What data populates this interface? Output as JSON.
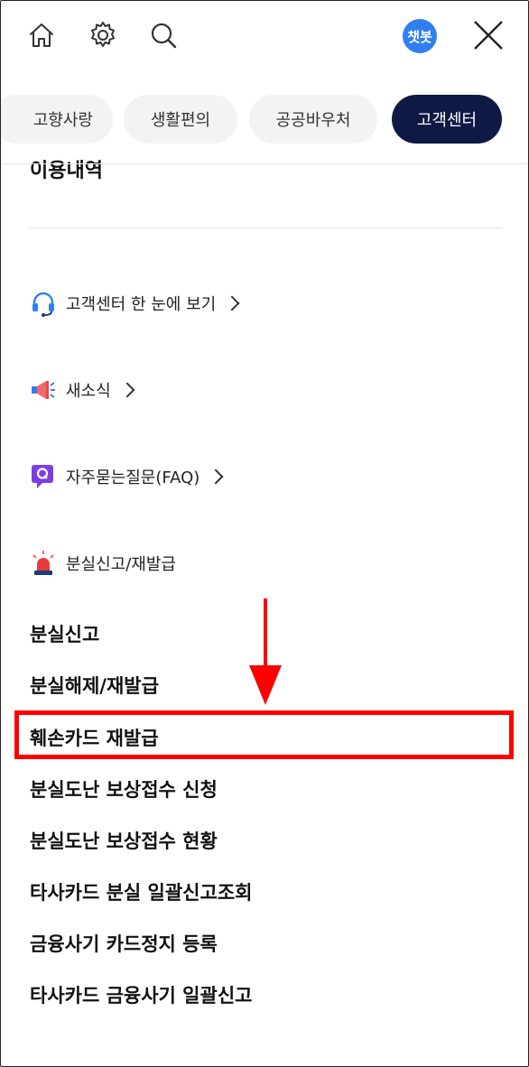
{
  "topbar": {
    "icons": [
      "home-icon",
      "gear-icon",
      "search-icon",
      "close-icon"
    ],
    "chatbot_label": "챗봇"
  },
  "chips": [
    {
      "label": "고향사랑",
      "active": false
    },
    {
      "label": "생활편의",
      "active": false
    },
    {
      "label": "공공바우처",
      "active": false
    },
    {
      "label": "고객센터",
      "active": true
    }
  ],
  "partial_heading": "이용내역",
  "menu_links": [
    {
      "label": "고객센터 한 눈에 보기",
      "icon": "headset-icon",
      "chevron": true
    },
    {
      "label": "새소식",
      "icon": "megaphone-icon",
      "chevron": true
    },
    {
      "label": "자주묻는질문(FAQ)",
      "icon": "faq-icon",
      "chevron": true
    },
    {
      "label": "분실신고/재발급",
      "icon": "siren-icon",
      "chevron": false
    }
  ],
  "sub_items": [
    "분실신고",
    "분실해제/재발급",
    "훼손카드 재발급",
    "분실도난 보상접수 신청",
    "분실도난 보상접수 현황",
    "타사카드 분실 일괄신고조회",
    "금융사기 카드정지 등록",
    "타사카드 금융사기 일괄신고"
  ],
  "colors": {
    "active_chip": "#0e1a45",
    "chatbot": "#2f7ff0",
    "highlight": "#ff0000"
  }
}
